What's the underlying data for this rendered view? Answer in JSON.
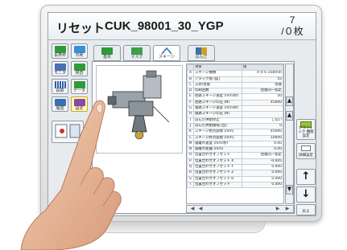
{
  "title": {
    "reset_label": "リセット",
    "file_name": "CUK_98001_30_YGP"
  },
  "counter": {
    "numerator": "7",
    "denominator": "/０枚"
  },
  "left_icons": [
    {
      "label": "長寿命",
      "color": "#2f9a3a"
    },
    {
      "label": "印刷",
      "color": "#3a8fd6"
    },
    {
      "label": "モニタ",
      "color": "#4a6fb0"
    },
    {
      "label": "検査",
      "color": "#2f9a3a"
    },
    {
      "label": "段取",
      "color": "#2d5fa8"
    },
    {
      "label": "データ",
      "color": "#2f9a3a"
    },
    {
      "label": "履歴",
      "color": "#3a6fb0"
    },
    {
      "label": "設定",
      "color": "#8a4aa0"
    }
  ],
  "tabs": [
    {
      "label": "基本",
      "color": "#2f9a3a"
    },
    {
      "label": "マスク",
      "color": "#3aa04a"
    },
    {
      "label": "スキージ",
      "color": "#3a6fb0"
    },
    {
      "label": "はんだ",
      "color": "#d0a020"
    }
  ],
  "table": {
    "headers": [
      "項目",
      "値"
    ],
    "rows": [
      {
        "id": "A",
        "name": "スキージ種類",
        "value": "メタル-350mm"
      },
      {
        "id": "B",
        "name": "アタック角 (度)",
        "value": "55"
      },
      {
        "id": "C",
        "name": "方式/往復",
        "value": "往復"
      },
      {
        "id": "D",
        "name": "印刷回数",
        "value": "往復同一指定"
      },
      {
        "id": "E",
        "name": "往路スキージ速度 (mm/秒)",
        "value": "50"
      },
      {
        "id": "F",
        "name": "往路スキージ印圧 (N)",
        "value": "45000"
      },
      {
        "id": "G",
        "name": "復路スキージ速度 (mm/秒)",
        "value": ""
      },
      {
        "id": "H",
        "name": "復路スキージ印圧 (N)",
        "value": ""
      },
      {
        "id": "I",
        "name": "はんだ供給停止",
        "value": "しない"
      },
      {
        "id": "J",
        "name": "はんだ供給間隔 (回)",
        "value": "0"
      },
      {
        "id": "K",
        "name": "スキージ始点座標 (mm)",
        "value": "45000"
      },
      {
        "id": "L",
        "name": "スキージ終点座標 (mm)",
        "value": "10000"
      },
      {
        "id": "M",
        "name": "版離れ速度 (mm/秒)",
        "value": "0.00"
      },
      {
        "id": "N",
        "name": "版離れ距離 (mm)",
        "value": "0.00"
      },
      {
        "id": "O",
        "name": "位置合わせオフセット",
        "value": "往復同一指定"
      },
      {
        "id": "P",
        "name": "位置合わせオフセット X",
        "value": "-0.005"
      },
      {
        "id": "Q",
        "name": "位置合わせオフセット Y",
        "value": "0.000"
      },
      {
        "id": "R",
        "name": "位置合わせオフセット Z",
        "value": "0.000"
      },
      {
        "id": "S",
        "name": "位置合わせオフセット θ",
        "value": "0.000"
      },
      {
        "id": "T",
        "name": "位置合わせオフセット",
        "value": "0.000"
      }
    ]
  },
  "right_buttons": {
    "graphic_label": "グラフィック 機能設定",
    "detail_label": "詳細設定",
    "up_arrow": "↑",
    "down_arrow": "↓",
    "return_label": "戻る"
  },
  "scroll": {
    "up": "▲",
    "down": "▼",
    "left": "◀",
    "left2": "◀",
    "right": "▶",
    "right2": "▶"
  },
  "colors": {
    "frame": "#e5e5e5",
    "screen": "#e8ebee",
    "accent_green": "#2f9a3a",
    "accent_blue": "#3a6fb0"
  }
}
